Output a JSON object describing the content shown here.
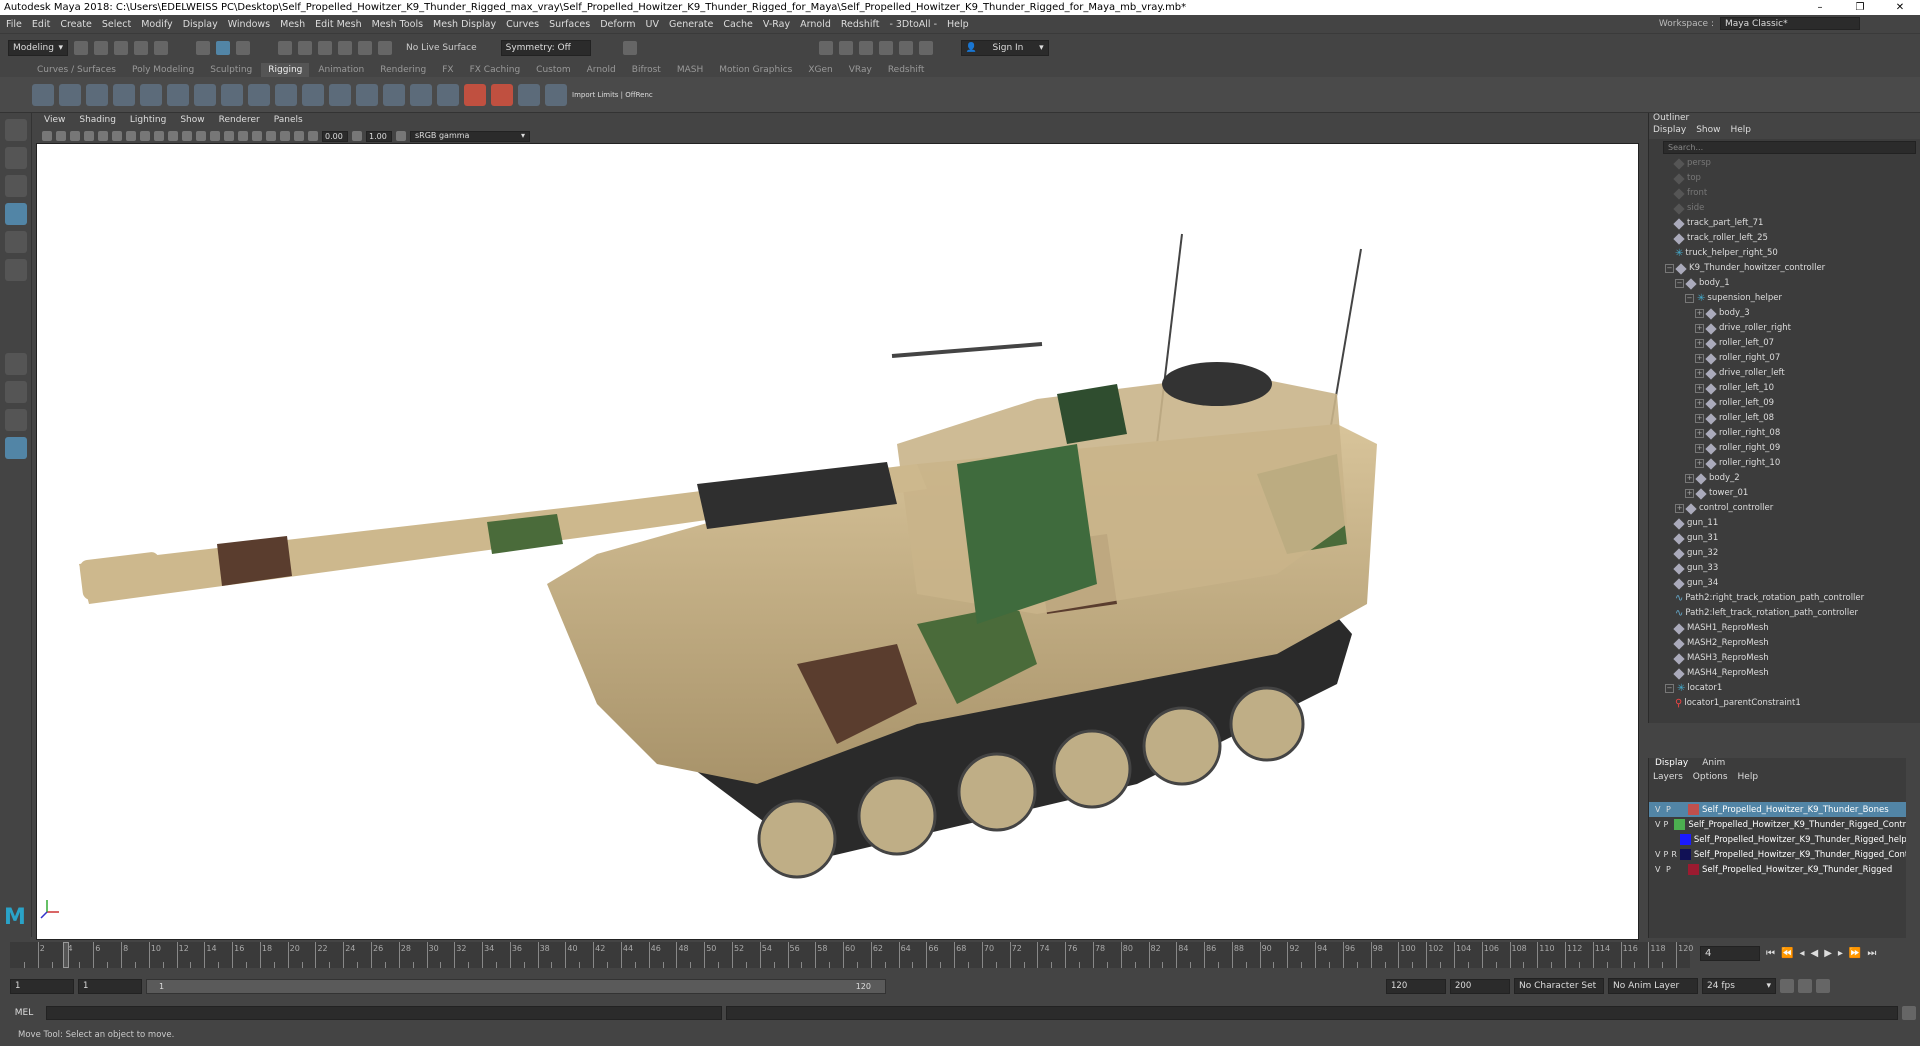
{
  "titlebar": {
    "text": "Autodesk Maya 2018: C:\\Users\\EDELWEISS PC\\Desktop\\Self_Propelled_Howitzer_K9_Thunder_Rigged_max_vray\\Self_Propelled_Howitzer_K9_Thunder_Rigged_for_Maya\\Self_Propelled_Howitzer_K9_Thunder_Rigged_for_Maya_mb_vray.mb*",
    "min": "–",
    "max": "❐",
    "close": "✕"
  },
  "menubar": [
    "File",
    "Edit",
    "Create",
    "Select",
    "Modify",
    "Display",
    "Windows",
    "Mesh",
    "Edit Mesh",
    "Mesh Tools",
    "Mesh Display",
    "Curves",
    "Surfaces",
    "Deform",
    "UV",
    "Generate",
    "Cache",
    "V-Ray",
    "Arnold",
    "Redshift",
    "- 3DtoAll -",
    "Help"
  ],
  "workspace": {
    "label": "Workspace :",
    "value": "Maya Classic*"
  },
  "statusline": {
    "mode": "Modeling",
    "live_surface": "No Live Surface",
    "symmetry": "Symmetry: Off",
    "sign_in": "Sign In"
  },
  "shelf_tabs": [
    "Curves / Surfaces",
    "Poly Modeling",
    "Sculpting",
    "Rigging",
    "Animation",
    "Rendering",
    "FX",
    "FX Caching",
    "Custom",
    "Arnold",
    "Bifrost",
    "MASH",
    "Motion Graphics",
    "XGen",
    "VRay",
    "Redshift"
  ],
  "shelf_active": "Rigging",
  "shelf_label": "Import Limits | OffRenc",
  "viewport_menu": [
    "View",
    "Shading",
    "Lighting",
    "Show",
    "Renderer",
    "Panels"
  ],
  "viewport_tools": {
    "near": "0.00",
    "gamma": "1.00",
    "colorspace": "sRGB gamma"
  },
  "outliner": {
    "title": "Outliner",
    "menu": [
      "Display",
      "Show",
      "Help"
    ],
    "search_placeholder": "Search...",
    "items": [
      {
        "label": "persp",
        "indent": 1,
        "type": "cam",
        "dim": true
      },
      {
        "label": "top",
        "indent": 1,
        "type": "cam",
        "dim": true
      },
      {
        "label": "front",
        "indent": 1,
        "type": "cam",
        "dim": true
      },
      {
        "label": "side",
        "indent": 1,
        "type": "cam",
        "dim": true
      },
      {
        "label": "track_part_left_71",
        "indent": 1,
        "type": "node"
      },
      {
        "label": "track_roller_left_25",
        "indent": 1,
        "type": "node"
      },
      {
        "label": "truck_helper_right_50",
        "indent": 1,
        "type": "loc"
      },
      {
        "label": "K9_Thunder_howitzer_controller",
        "indent": 0,
        "type": "node",
        "exp": "−"
      },
      {
        "label": "body_1",
        "indent": 1,
        "type": "node",
        "exp": "−"
      },
      {
        "label": "supension_helper",
        "indent": 2,
        "type": "loc",
        "exp": "−"
      },
      {
        "label": "body_3",
        "indent": 3,
        "type": "node",
        "exp": "+"
      },
      {
        "label": "drive_roller_right",
        "indent": 3,
        "type": "node",
        "exp": "+"
      },
      {
        "label": "roller_left_07",
        "indent": 3,
        "type": "node",
        "exp": "+"
      },
      {
        "label": "roller_right_07",
        "indent": 3,
        "type": "node",
        "exp": "+"
      },
      {
        "label": "drive_roller_left",
        "indent": 3,
        "type": "node",
        "exp": "+"
      },
      {
        "label": "roller_left_10",
        "indent": 3,
        "type": "node",
        "exp": "+"
      },
      {
        "label": "roller_left_09",
        "indent": 3,
        "type": "node",
        "exp": "+"
      },
      {
        "label": "roller_left_08",
        "indent": 3,
        "type": "node",
        "exp": "+"
      },
      {
        "label": "roller_right_08",
        "indent": 3,
        "type": "node",
        "exp": "+"
      },
      {
        "label": "roller_right_09",
        "indent": 3,
        "type": "node",
        "exp": "+"
      },
      {
        "label": "roller_right_10",
        "indent": 3,
        "type": "node",
        "exp": "+"
      },
      {
        "label": "body_2",
        "indent": 2,
        "type": "node",
        "exp": "+"
      },
      {
        "label": "tower_01",
        "indent": 2,
        "type": "node",
        "exp": "+"
      },
      {
        "label": "control_controller",
        "indent": 1,
        "type": "node",
        "exp": "+"
      },
      {
        "label": "gun_11",
        "indent": 1,
        "type": "node"
      },
      {
        "label": "gun_31",
        "indent": 1,
        "type": "node"
      },
      {
        "label": "gun_32",
        "indent": 1,
        "type": "node"
      },
      {
        "label": "gun_33",
        "indent": 1,
        "type": "node"
      },
      {
        "label": "gun_34",
        "indent": 1,
        "type": "node"
      },
      {
        "label": "Path2:right_track_rotation_path_controller",
        "indent": 1,
        "type": "curve"
      },
      {
        "label": "Path2:left_track_rotation_path_controller",
        "indent": 1,
        "type": "curve"
      },
      {
        "label": "MASH1_ReproMesh",
        "indent": 1,
        "type": "node"
      },
      {
        "label": "MASH2_ReproMesh",
        "indent": 1,
        "type": "node"
      },
      {
        "label": "MASH3_ReproMesh",
        "indent": 1,
        "type": "node"
      },
      {
        "label": "MASH4_ReproMesh",
        "indent": 1,
        "type": "node"
      },
      {
        "label": "locator1",
        "indent": 0,
        "type": "loc",
        "exp": "−"
      },
      {
        "label": "locator1_parentConstraint1",
        "indent": 1,
        "type": "con"
      }
    ]
  },
  "layers": {
    "tabs": [
      "Display",
      "Anim"
    ],
    "menu": [
      "Layers",
      "Options",
      "Help"
    ],
    "rows": [
      {
        "v": "V",
        "p": "P",
        "r": "",
        "color": "#c0504d",
        "name": "Self_Propelled_Howitzer_K9_Thunder_Bones",
        "selected": true
      },
      {
        "v": "V",
        "p": "P",
        "r": "",
        "color": "#4caf50",
        "name": "Self_Propelled_Howitzer_K9_Thunder_Rigged_Controll"
      },
      {
        "v": "",
        "p": "",
        "r": "",
        "color": "#1a1aff",
        "name": "Self_Propelled_Howitzer_K9_Thunder_Rigged_helpe"
      },
      {
        "v": "V",
        "p": "P",
        "r": "R",
        "color": "#111155",
        "name": "Self_Propelled_Howitzer_K9_Thunder_Rigged_Controll"
      },
      {
        "v": "V",
        "p": "P",
        "r": "",
        "color": "#9b1b30",
        "name": "Self_Propelled_Howitzer_K9_Thunder_Rigged"
      }
    ]
  },
  "timeline": {
    "labels": [
      "2",
      "4",
      "6",
      "8",
      "10",
      "12",
      "14",
      "16",
      "18",
      "20",
      "22",
      "24",
      "26",
      "28",
      "30",
      "32",
      "34",
      "36",
      "38",
      "40",
      "42",
      "44",
      "46",
      "48",
      "50",
      "52",
      "54",
      "56",
      "58",
      "60",
      "62",
      "64",
      "66",
      "68",
      "70",
      "72",
      "74",
      "76",
      "78",
      "80",
      "82",
      "84",
      "86",
      "88",
      "90",
      "92",
      "94",
      "96",
      "98",
      "100",
      "102",
      "104",
      "106",
      "108",
      "110",
      "112",
      "114",
      "116",
      "118",
      "120"
    ],
    "current_frame": "4",
    "current_field": "4"
  },
  "range": {
    "start": "1",
    "start2": "1",
    "inner_start": "1",
    "inner_end": "120",
    "end": "120",
    "end2": "200",
    "character_set": "No Character Set",
    "anim_layer": "No Anim Layer",
    "fps": "24 fps"
  },
  "cmdline": {
    "label": "MEL"
  },
  "helpline": "Move Tool: Select an object to move."
}
